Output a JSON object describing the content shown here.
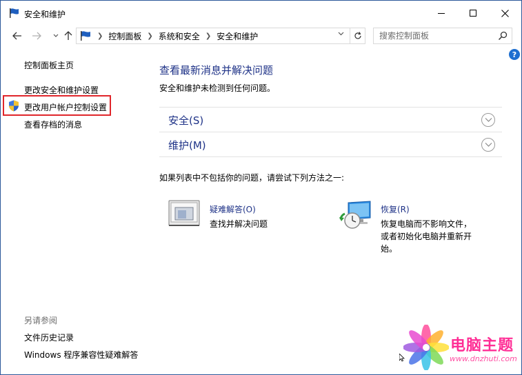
{
  "window": {
    "title": "安全和维护",
    "controls": {
      "minimize": "min",
      "maximize": "max",
      "close": "✕"
    }
  },
  "address_bar": {
    "breadcrumbs": [
      "控制面板",
      "系统和安全",
      "安全和维护"
    ],
    "search_placeholder": "搜索控制面板"
  },
  "sidebar": {
    "home": "控制面板主页",
    "change_security_settings": "更改安全和维护设置",
    "change_uac_settings": "更改用户帐户控制设置",
    "view_archived_messages": "查看存档的消息",
    "see_also_heading": "另请参阅",
    "file_history": "文件历史记录",
    "compat_troubleshooter": "Windows 程序兼容性疑难解答"
  },
  "main": {
    "heading": "查看最新消息并解决问题",
    "status": "安全和维护未检测到任何问题。",
    "sections": [
      {
        "label": "安全(S)"
      },
      {
        "label": "维护(M)"
      }
    ],
    "suggestion": "如果列表中不包括你的问题，请尝试下列方法之一:",
    "troubleshooting": {
      "title": "疑难解答(O)",
      "description": "查找并解决问题"
    },
    "recovery": {
      "title": "恢复(R)",
      "description_lines": [
        "恢复电脑而不影响文件，",
        "或者初始化电脑并重新开",
        "始。"
      ]
    }
  },
  "watermark": {
    "title": "电脑主题",
    "url": "www.dnzhuti.com"
  },
  "colors": {
    "link_blue": "#1e3287",
    "highlight_red": "#e0252a",
    "watermark_pink": "#ff2d95"
  }
}
